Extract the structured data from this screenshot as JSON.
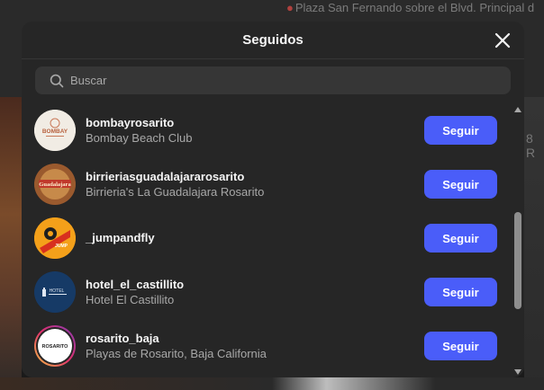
{
  "background": {
    "location_text": "Plaza San Fernando sobre el Blvd. Principal d",
    "edge_text": "8 R"
  },
  "modal": {
    "title": "Seguidos",
    "search": {
      "placeholder": "Buscar",
      "value": ""
    },
    "follow_label": "Seguir",
    "accounts": [
      {
        "username": "bombayrosarito",
        "full_name": "Bombay Beach Club",
        "avatar_text": "BOMBAY"
      },
      {
        "username": "birrieriasguadalajararosarito",
        "full_name": "Birrieria's La Guadalajara Rosarito",
        "avatar_text": "Guadalajara"
      },
      {
        "username": "_jumpandfly",
        "full_name": "",
        "avatar_text": "JUMP"
      },
      {
        "username": "hotel_el_castillito",
        "full_name": "Hotel El Castillito",
        "avatar_text": "HOTEL"
      },
      {
        "username": "rosarito_baja",
        "full_name": "Playas de Rosarito, Baja California",
        "avatar_text": "ROSARITO"
      }
    ],
    "scroll_progress": 0.45
  },
  "colors": {
    "modal_bg": "#262626",
    "accent": "#4a5df9",
    "secondary_text": "#a8a8a8"
  }
}
